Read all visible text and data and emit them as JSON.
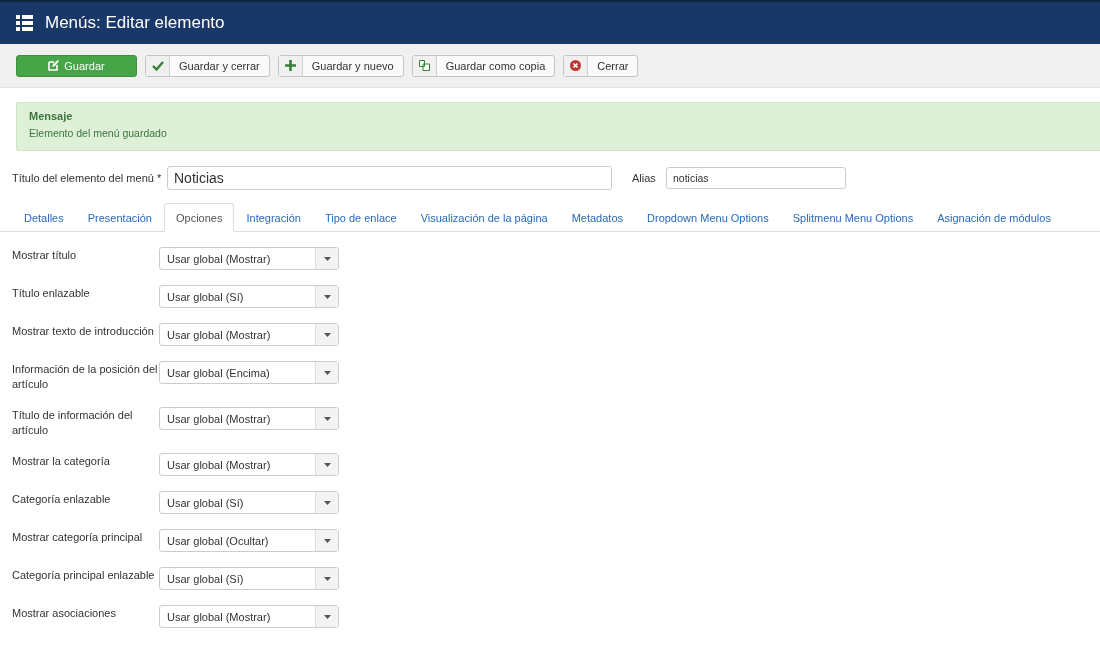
{
  "header": {
    "title": "Menús: Editar elemento"
  },
  "toolbar": [
    {
      "label": "Guardar",
      "kind": "primary"
    },
    {
      "label": "Guardar y cerrar",
      "kind": "default"
    },
    {
      "label": "Guardar y nuevo",
      "kind": "default"
    },
    {
      "label": "Guardar como copia",
      "kind": "default"
    },
    {
      "label": "Cerrar",
      "kind": "default"
    }
  ],
  "message": {
    "heading": "Mensaje",
    "text": "Elemento del menú guardado"
  },
  "title_field": {
    "label": "Título del elemento del menú *",
    "value": "Noticias"
  },
  "alias_field": {
    "label": "Alias",
    "value": "noticias"
  },
  "tabs": [
    {
      "label": "Detalles",
      "selected": false
    },
    {
      "label": "Presentación",
      "selected": false
    },
    {
      "label": "Opciones",
      "selected": true
    },
    {
      "label": "Integración",
      "selected": false
    },
    {
      "label": "Tipo de enlace",
      "selected": false
    },
    {
      "label": "Visualización de la página",
      "selected": false
    },
    {
      "label": "Metadatos",
      "selected": false
    },
    {
      "label": "Dropdown Menu Options",
      "selected": false
    },
    {
      "label": "Splitmenu Menu Options",
      "selected": false
    },
    {
      "label": "Asignación de módulos",
      "selected": false
    }
  ],
  "options": [
    {
      "label": "Mostrar título",
      "value": "Usar global (Mostrar)"
    },
    {
      "label": "Título enlazable",
      "value": "Usar global (Sí)"
    },
    {
      "label": "Mostrar texto de introducción",
      "value": "Usar global (Mostrar)"
    },
    {
      "label": "Información de la posición del artículo",
      "value": "Usar global (Encima)"
    },
    {
      "label": "Título de información del artículo",
      "value": "Usar global (Mostrar)"
    },
    {
      "label": "Mostrar la categoría",
      "value": "Usar global (Mostrar)"
    },
    {
      "label": "Categoría enlazable",
      "value": "Usar global (Sí)"
    },
    {
      "label": "Mostrar categoría principal",
      "value": "Usar global (Ocultar)"
    },
    {
      "label": "Categoría principal enlazable",
      "value": "Usar global (Sí)"
    },
    {
      "label": "Mostrar asociaciones",
      "value": "Usar global (Mostrar)"
    }
  ]
}
